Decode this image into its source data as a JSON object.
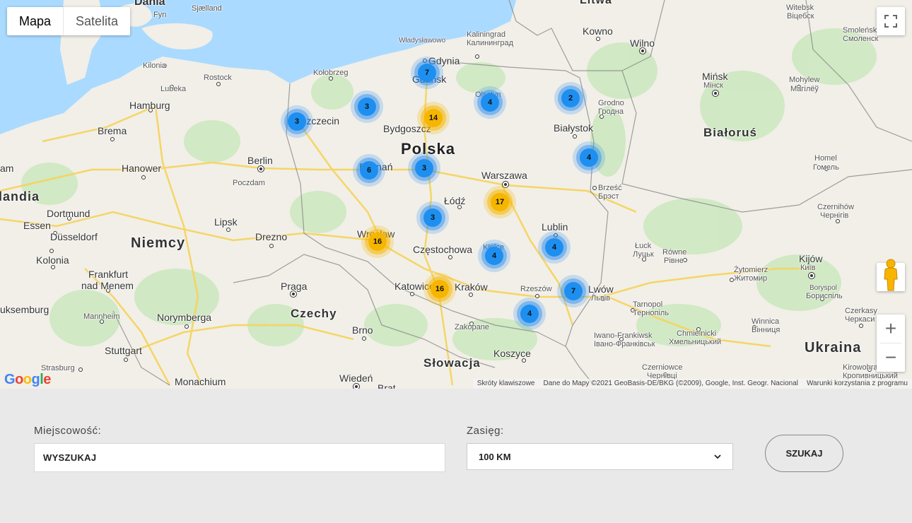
{
  "map": {
    "map_type": {
      "map": "Mapa",
      "satellite": "Satelita"
    },
    "labels": {
      "dania": "Dania",
      "fyn": "Fyn",
      "sjaelland": "Sjælland",
      "litwa": "Litwa",
      "witebsk": "Witebsk",
      "witebsk_cy": "Віцебск",
      "smolensk": "Smoleńsk",
      "smolensk_cy": "Смоленск",
      "kaliningrad": "Kaliningrad",
      "kaliningrad_cy": "Калининград",
      "wladyslawowo": "Władysławowo",
      "gdynia": "Gdynia",
      "gdansk": "Gdańsk",
      "kowno": "Kowno",
      "wilno": "Wilno",
      "kilonia": "Kilonia",
      "lubeka": "Lubeka",
      "rostock": "Rostock",
      "kolobrzeg": "Kołobrzeg",
      "olsztyn": "Olsztyn",
      "minsk": "Mińsk",
      "minsk_cy": "Мінск",
      "mohylew": "Mohylew",
      "mohylew_cy": "Магілёў",
      "hamburg": "Hamburg",
      "szczecin": "Szczecin",
      "bydgoszcz": "Bydgoszcz",
      "grodno": "Grodno",
      "grodno_cy": "Гродна",
      "bialystok": "Białystok",
      "brema": "Brema",
      "bialorus": "Białoruś",
      "polska": "Polska",
      "berlin": "Berlin",
      "hanower": "Hanower",
      "poznan": "Poznań",
      "warszawa": "Warszawa",
      "homel": "Homel",
      "homel_cy": "Гомель",
      "poczdam": "Poczdam",
      "am": "am",
      "brzesc": "Brześć",
      "brzesc_cy": "Брэст",
      "landia": "landia",
      "lodz": "Łódź",
      "dortmund": "Dortmund",
      "czernihow": "Czernihów",
      "czernihow_cy": "Чернігів",
      "essen": "Essen",
      "lipsk": "Lipsk",
      "dusseldorf": "Düsseldorf",
      "drezno": "Drezno",
      "lublin": "Lublin",
      "niemcy": "Niemcy",
      "wroclaw": "Wrocław",
      "kolonia": "Kolonia",
      "czestochowa": "Częstochowa",
      "kielce": "Kielce",
      "luck": "Łuck",
      "luck_cy": "Луцьк",
      "rowne": "Równe",
      "rowne_cy": "Рівне",
      "kijow": "Kijów",
      "kijow_cy": "Київ",
      "frankfurt1": "Frankfurt",
      "frankfurt2": "nad Menem",
      "zytomierz": "Żytomierz",
      "zytomierz_cy": "Житомир",
      "praga": "Praga",
      "katowice": "Katowice",
      "krakow": "Kraków",
      "rzeszow": "Rzeszów",
      "lwow": "Lwów",
      "lwow_cy": "Львів",
      "borysopil": "Boryspol",
      "borysopil_cy": "Бориспіль",
      "luksemburg": "uksemburg",
      "czechy": "Czechy",
      "mannheim": "Mannheim",
      "norymberga": "Norymberga",
      "tarnopol": "Tarnopol",
      "tarnopol_cy": "Тернопіль",
      "winnica": "Winnica",
      "winnica_cy": "Вінниця",
      "czerkasy": "Czerkasy",
      "czerkasy_cy": "Черкаси",
      "zakopane": "Zakopane",
      "brno": "Brno",
      "iwano1": "Iwano-Frankiwsk",
      "iwano2": "Івано-Франківськ",
      "chmielnicki": "Chmielnicki",
      "chmielnicki_cy": "Хмельницький",
      "stuttgart": "Stuttgart",
      "koszyce": "Koszyce",
      "ukraina": "Ukraina",
      "strasburg": "Strasburg",
      "slowacja": "Słowacja",
      "czerniowce": "Czerniowce",
      "czerniowce_cy": "Чернівці",
      "kirowohrad": "Kirowohrad",
      "kirowohrad_cy": "Кропивницький",
      "monachium": "Monachium",
      "wieden": "Wiedeń",
      "bratyslawa": "Brat"
    },
    "clusters": [
      {
        "count": "7",
        "color": "blue"
      },
      {
        "count": "3",
        "color": "blue"
      },
      {
        "count": "3",
        "color": "blue"
      },
      {
        "count": "14",
        "color": "yellow"
      },
      {
        "count": "4",
        "color": "blue"
      },
      {
        "count": "2",
        "color": "blue"
      },
      {
        "count": "6",
        "color": "blue"
      },
      {
        "count": "3",
        "color": "blue"
      },
      {
        "count": "4",
        "color": "blue"
      },
      {
        "count": "17",
        "color": "yellow"
      },
      {
        "count": "3",
        "color": "blue"
      },
      {
        "count": "16",
        "color": "yellow"
      },
      {
        "count": "4",
        "color": "blue"
      },
      {
        "count": "4",
        "color": "blue"
      },
      {
        "count": "16",
        "color": "yellow"
      },
      {
        "count": "7",
        "color": "blue"
      },
      {
        "count": "4",
        "color": "blue"
      }
    ],
    "attribution": {
      "shortcuts": "Skróty klawiszowe",
      "data": "Dane do Mapy ©2021 GeoBasis-DE/BKG (©2009), Google, Inst. Geogr. Nacional",
      "terms": "Warunki korzystania z programu"
    },
    "zoom_in": "+",
    "zoom_out": "−"
  },
  "form": {
    "location_label": "Miejscowość:",
    "location_value": "WYSZUKAJ",
    "range_label": "Zasięg:",
    "range_value": "100 KM",
    "search_button": "SZUKAJ"
  },
  "colors": {
    "water": "#aadaff",
    "land": "#f1efe8",
    "green": "#cde8c0",
    "blue_cluster": "#1d8ff0",
    "yellow_cluster": "#f6b600",
    "road": "#f7d358"
  }
}
